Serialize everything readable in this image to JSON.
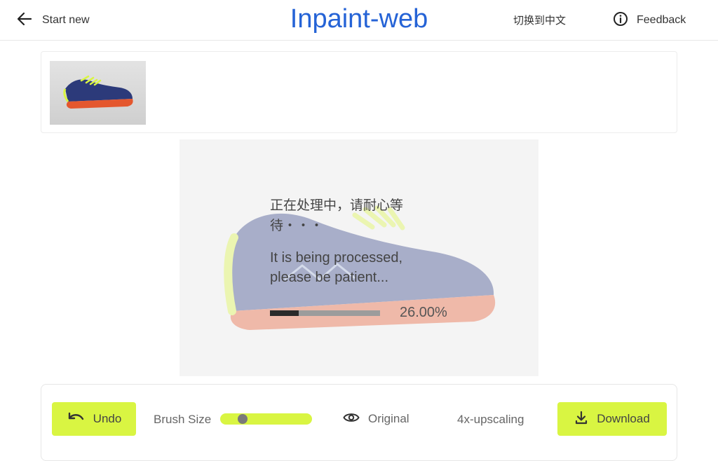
{
  "header": {
    "start_new_label": "Start new",
    "title": "Inpaint-web",
    "language_switch": "切换到中文",
    "feedback_label": "Feedback"
  },
  "processing": {
    "message_cn": "正在处理中，请耐心等待・・・",
    "message_en": "It is being processed, please be patient...",
    "progress_text": "26.00%",
    "progress_fraction": 0.26
  },
  "toolbar": {
    "undo_label": "Undo",
    "brush_size_label": "Brush Size",
    "brush_size_fraction": 0.2,
    "original_label": "Original",
    "upscale_label": "4x-upscaling",
    "download_label": "Download"
  },
  "colors": {
    "accent": "#d9f542",
    "title": "#2563d6"
  },
  "icons": {
    "start_new": "arrow-left-icon",
    "feedback": "info-circle-icon",
    "undo": "undo-icon",
    "original": "eye-icon",
    "download": "download-icon"
  }
}
